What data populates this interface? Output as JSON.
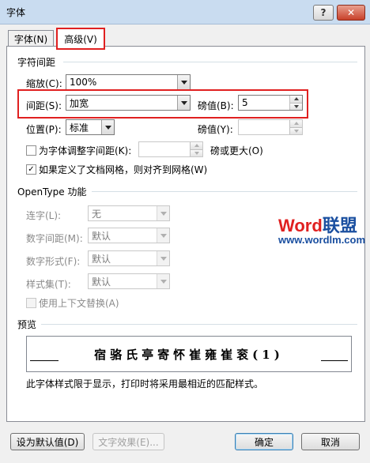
{
  "window": {
    "title": "字体",
    "help_label": "?",
    "close_label": "✕"
  },
  "tabs": [
    {
      "label": "字体(N)"
    },
    {
      "label": "高级(V)"
    }
  ],
  "spacing": {
    "heading": "字符间距",
    "scale_label": "缩放(C):",
    "scale_value": "100%",
    "spacing_label": "间距(S):",
    "spacing_value": "加宽",
    "spacing_by_label": "磅值(B):",
    "spacing_by_value": "5",
    "position_label": "位置(P):",
    "position_value": "标准",
    "position_by_label": "磅值(Y):",
    "position_by_value": "",
    "kerning_label": "为字体调整字间距(K):",
    "kerning_value": "",
    "kerning_suffix": "磅或更大(O)",
    "snap_label": "如果定义了文档网格，则对齐到网格(W)"
  },
  "opentype": {
    "heading": "OpenType 功能",
    "ligatures_label": "连字(L):",
    "ligatures_value": "无",
    "num_spacing_label": "数字间距(M):",
    "num_spacing_value": "默认",
    "num_forms_label": "数字形式(F):",
    "num_forms_value": "默认",
    "stylistic_label": "样式集(T):",
    "stylistic_value": "默认",
    "contextual_label": "使用上下文替换(A)"
  },
  "preview": {
    "heading": "预览",
    "sample": "宿骆氏亭寄怀崔雍崔衮(1)",
    "note": "此字体样式限于显示，打印时将采用最相近的匹配样式。"
  },
  "watermark": {
    "brand_word": "Word",
    "brand_cn": "联盟",
    "url": "www.wordlm.com",
    "brand_word_color": "#e02020",
    "brand_cn_color": "#1a4fa0"
  },
  "buttons": {
    "set_default": "设为默认值(D)",
    "text_effects": "文字效果(E)...",
    "ok": "确定",
    "cancel": "取消"
  }
}
